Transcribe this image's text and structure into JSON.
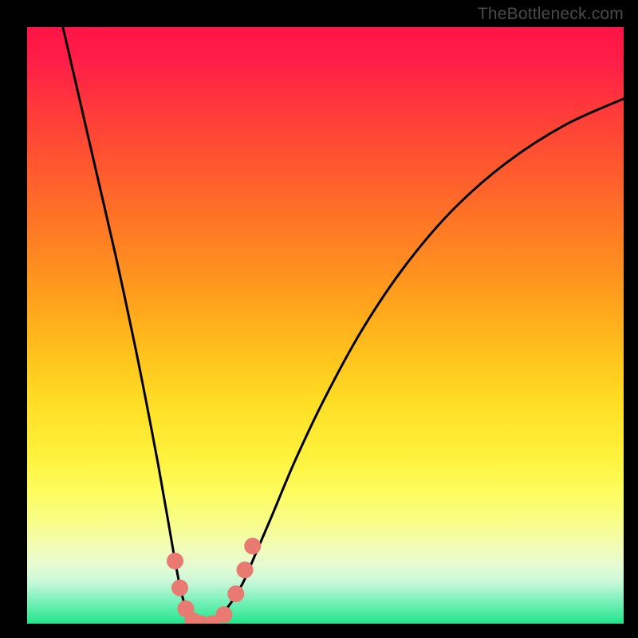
{
  "watermark": "TheBottleneck.com",
  "chart_data": {
    "type": "line",
    "title": "",
    "xlabel": "",
    "ylabel": "",
    "xlim": [
      0,
      1
    ],
    "ylim": [
      0,
      1
    ],
    "series": [
      {
        "name": "curve",
        "x": [
          0.06,
          0.09,
          0.12,
          0.15,
          0.18,
          0.2,
          0.22,
          0.235,
          0.248,
          0.258,
          0.268,
          0.28,
          0.3,
          0.33,
          0.36,
          0.38,
          0.41,
          0.45,
          0.5,
          0.56,
          0.63,
          0.71,
          0.8,
          0.9,
          1.0
        ],
        "y": [
          1.0,
          0.87,
          0.74,
          0.61,
          0.47,
          0.37,
          0.265,
          0.18,
          0.105,
          0.055,
          0.02,
          0.0,
          0.0,
          0.02,
          0.065,
          0.11,
          0.18,
          0.275,
          0.38,
          0.49,
          0.595,
          0.69,
          0.77,
          0.835,
          0.88
        ]
      },
      {
        "name": "dots",
        "x": [
          0.248,
          0.256,
          0.266,
          0.278,
          0.292,
          0.31,
          0.33,
          0.35,
          0.365,
          0.378
        ],
        "y": [
          0.105,
          0.06,
          0.025,
          0.005,
          0.0,
          0.0,
          0.015,
          0.05,
          0.09,
          0.13
        ]
      }
    ],
    "gradient_stops": [
      {
        "pos": 0.0,
        "color": "#ff1446"
      },
      {
        "pos": 0.5,
        "color": "#ffd61f"
      },
      {
        "pos": 0.82,
        "color": "#fbfd7a"
      },
      {
        "pos": 1.0,
        "color": "#22e58d"
      }
    ]
  }
}
